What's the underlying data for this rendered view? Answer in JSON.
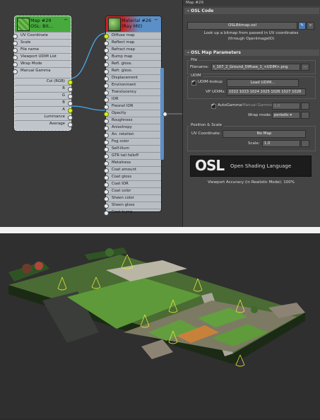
{
  "map_node": {
    "title_line1": "Map #29",
    "title_line2": "OSL: Bit...",
    "inputs": [
      "UV Coordinate",
      "Scale",
      "File name",
      "Viewport UDIM List",
      "Wrap Mode",
      "Manual Gamma"
    ],
    "outputs": [
      "Col (RGB)",
      "R",
      "G",
      "B",
      "A",
      "Luminance",
      "Average"
    ]
  },
  "material_node": {
    "title_line1": "Material #26",
    "title_line2": "(Ray Mtl)",
    "slots": [
      "Diffuse map",
      "Reflect map",
      "Refract map",
      "Bump map",
      "Refl. gloss.",
      "Refr. gloss.",
      "Displacement",
      "Environment",
      "Translucency",
      "IOR",
      "Fresnel IOR",
      "Opacity",
      "Roughness",
      "Anisotropy",
      "An. rotation",
      "Fog color",
      "Self-illum",
      "GTR tail falloff",
      "Metalness",
      "Coat amount",
      "Coat gloss",
      "Coat IOR",
      "Coat color",
      "Sheen color",
      "Sheen gloss",
      "Coat bump"
    ]
  },
  "panel": {
    "window_title": "Map #29",
    "osl_code": {
      "header": "OSL Code",
      "file_button": "OSLBitmap.osl",
      "description_line1": "Look up a bitmap from passed in UV coordinates",
      "description_line2": "(through OpenImageIO)"
    },
    "osl_params": {
      "header": "OSL Map Parameters",
      "file_group": "File",
      "filename_label": "Filename:",
      "filename_value": "t_107_2_Ground_Diffuse_1_<UDIM>.png",
      "udim_group": "UDIM",
      "udim_lookup_label": "UDIM-lookup",
      "load_udim_button": "Load UDIM...",
      "vp_udims_label": "VP UDIMs:",
      "vp_udims_value": "1022 1023 1024 1025 1026 1027 1028",
      "autogamma_label": "AutoGamma",
      "manual_gamma_label": "Manual Gamma:",
      "manual_gamma_value": "1.0",
      "wrap_mode_label": "Wrap mode:",
      "wrap_mode_value": "periodic",
      "position_group": "Position & Scale",
      "uv_coord_label": "UV Coordinate:",
      "uv_coord_value": "No Map",
      "scale_label": "Scale:",
      "scale_value": "1.0",
      "logo_word": "OSL",
      "logo_tagline": "Open Shading Language",
      "viewport_accuracy": "Viewport Accuracy (in Realistic Mode): 100%"
    }
  },
  "colors": {
    "slate_bg": "#3c3c3c",
    "node_body": "#b8bec4",
    "socket_connected": "#d7f516",
    "wire": "#4aa8e8",
    "map_header": "#46aa3c",
    "material_header": "#c82323",
    "panel_bg": "#444444",
    "grass": "#5e9a3a"
  }
}
